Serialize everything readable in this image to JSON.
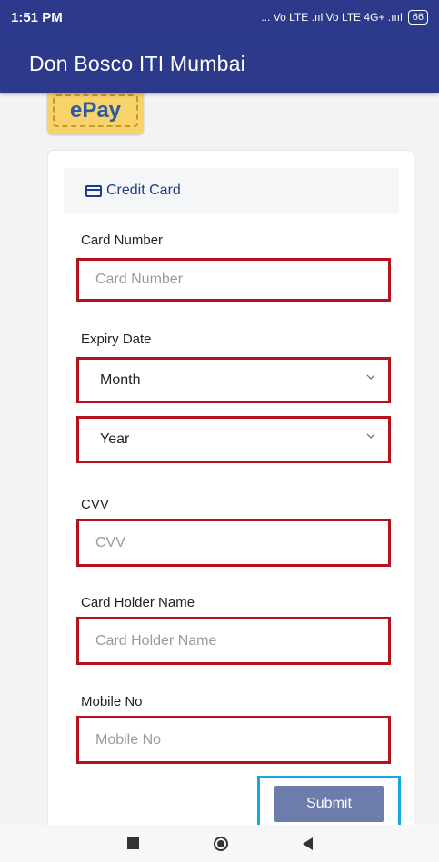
{
  "status_bar": {
    "time": "1:51 PM",
    "indicators": "... Vo LTE .ııl Vo LTE 4G+ .ıııl",
    "battery": "66"
  },
  "app_bar": {
    "title": "Don Bosco ITI Mumbai"
  },
  "logo": {
    "text": "ePay"
  },
  "card": {
    "header_icon": "credit-card-icon",
    "header_label": "Credit Card",
    "fields": {
      "card_number": {
        "label": "Card Number",
        "placeholder": "Card Number"
      },
      "expiry": {
        "label": "Expiry Date",
        "month_value": "Month",
        "year_value": "Year"
      },
      "cvv": {
        "label": "CVV",
        "placeholder": "CVV"
      },
      "holder_name": {
        "label": "Card Holder Name",
        "placeholder": "Card Holder Name"
      },
      "mobile": {
        "label": "Mobile No",
        "placeholder": "Mobile No"
      }
    },
    "submit_label": "Submit"
  },
  "colors": {
    "primary": "#2d3a8c",
    "field_border": "#b5121b",
    "highlight": "#14a8e0",
    "submit": "#6d7cab"
  },
  "nav_bar": {
    "icons": [
      "recents-square-icon",
      "home-circle-icon",
      "back-triangle-icon"
    ]
  }
}
